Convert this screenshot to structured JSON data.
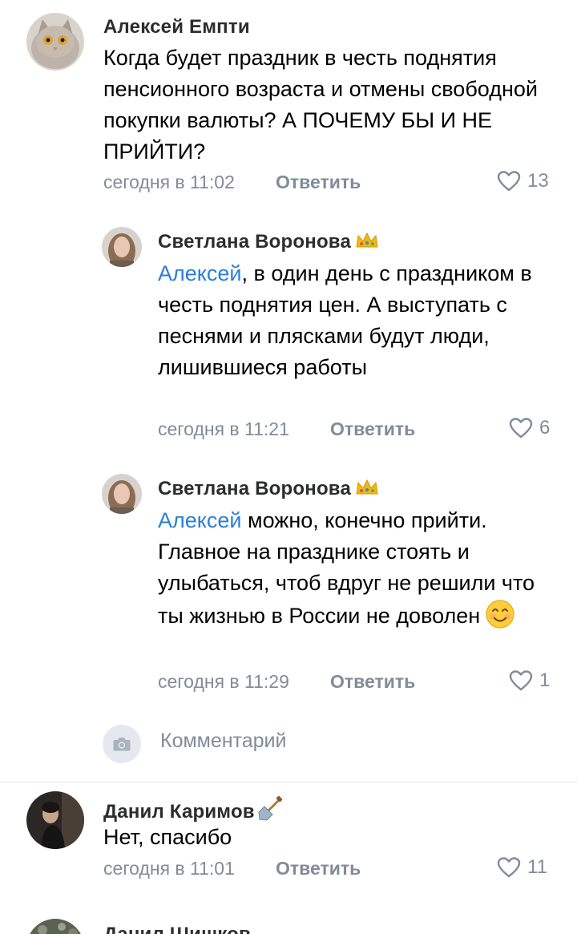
{
  "comments": [
    {
      "author": "Алексей Емпти",
      "text": "Когда будет праздник в честь поднятия пенсионного возраста и отмены свободной покупки валюты? А ПОЧЕМУ БЫ И НЕ ПРИЙТИ?",
      "time": "сегодня в 11:02",
      "reply_label": "Ответить",
      "likes": "13"
    },
    {
      "author": "Светлана Воронова",
      "mention": "Алексей",
      "text": ", в один день с праздником в честь поднятия цен. А выступать с песнями и плясками будут люди, лишившиеся работы",
      "time": "сегодня в 11:21",
      "reply_label": "Ответить",
      "likes": "6"
    },
    {
      "author": "Светлана Воронова",
      "mention": "Алексей",
      "text": " можно, конечно прийти. Главное на празднике стоять и улыбаться, чтоб вдруг не решили что ты жизнью в России не доволен",
      "time": "сегодня в 11:29",
      "reply_label": "Ответить",
      "likes": "1"
    },
    {
      "author": "Данил Каримов",
      "text": "Нет, спасибо",
      "time": "сегодня в 11:01",
      "reply_label": "Ответить",
      "likes": "11"
    },
    {
      "author": "Данил Шишков"
    }
  ],
  "reply_box": {
    "placeholder": "Комментарий"
  },
  "icons": {
    "like": "heart-outline-icon",
    "camera": "camera-icon",
    "crown": "crown-emoji-icon",
    "shovel": "shovel-emoji-icon",
    "smile": "smiling-face-emoji-icon"
  },
  "colors": {
    "mention": "#2a7fd4",
    "meta": "#818c99",
    "name": "#2c2d2e"
  }
}
